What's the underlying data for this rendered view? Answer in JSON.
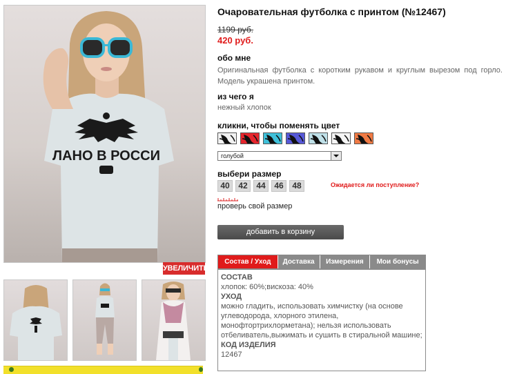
{
  "product": {
    "title": "Очаровательная футболка с принтом (№12467)",
    "old_price": "1199 руб.",
    "new_price": "420 руб."
  },
  "gallery": {
    "zoom_label": "УВЕЛИЧИТЬ",
    "print_text": "ЛАНО В РОССИ"
  },
  "about": {
    "heading": "обо мне",
    "text": "Оригинальная футболка с коротким рукавом и круглым вырезом под горло. Модель украшена принтом."
  },
  "material": {
    "heading": "из чего я",
    "text": "нежный хлопок"
  },
  "color": {
    "heading": "кликни, чтобы поменять цвет",
    "swatches": [
      "#f2f2f2",
      "#e5252d",
      "#3fc0d9",
      "#5658d8",
      "#bfe0e8",
      "#f5f5f5",
      "#f07a44"
    ],
    "selected": "голубой"
  },
  "size": {
    "heading": "выбери размер",
    "options": [
      "40",
      "42",
      "44",
      "46",
      "48"
    ],
    "waiting_link": "Ожидается ли поступление?",
    "check_link": "проверь свой размер"
  },
  "cart": {
    "button_label": "добавить в корзину"
  },
  "tabs": [
    "Состав / Уход",
    "Доставка",
    "Измерения",
    "Мои бонусы"
  ],
  "details": {
    "composition_heading": "СОСТАВ",
    "composition": "хлопок: 60%;вискоза: 40%",
    "care_heading": "УХОД",
    "care": "можно гладить, использовать химчистку (на основе углеводорода, хлорного этилена, монофтортрихлорметана); нельзя использовать отбеливатель,выжимать и сушить в стиральной машине;",
    "code_heading": "КОД ИЗДЕЛИЯ",
    "code": "12467"
  }
}
